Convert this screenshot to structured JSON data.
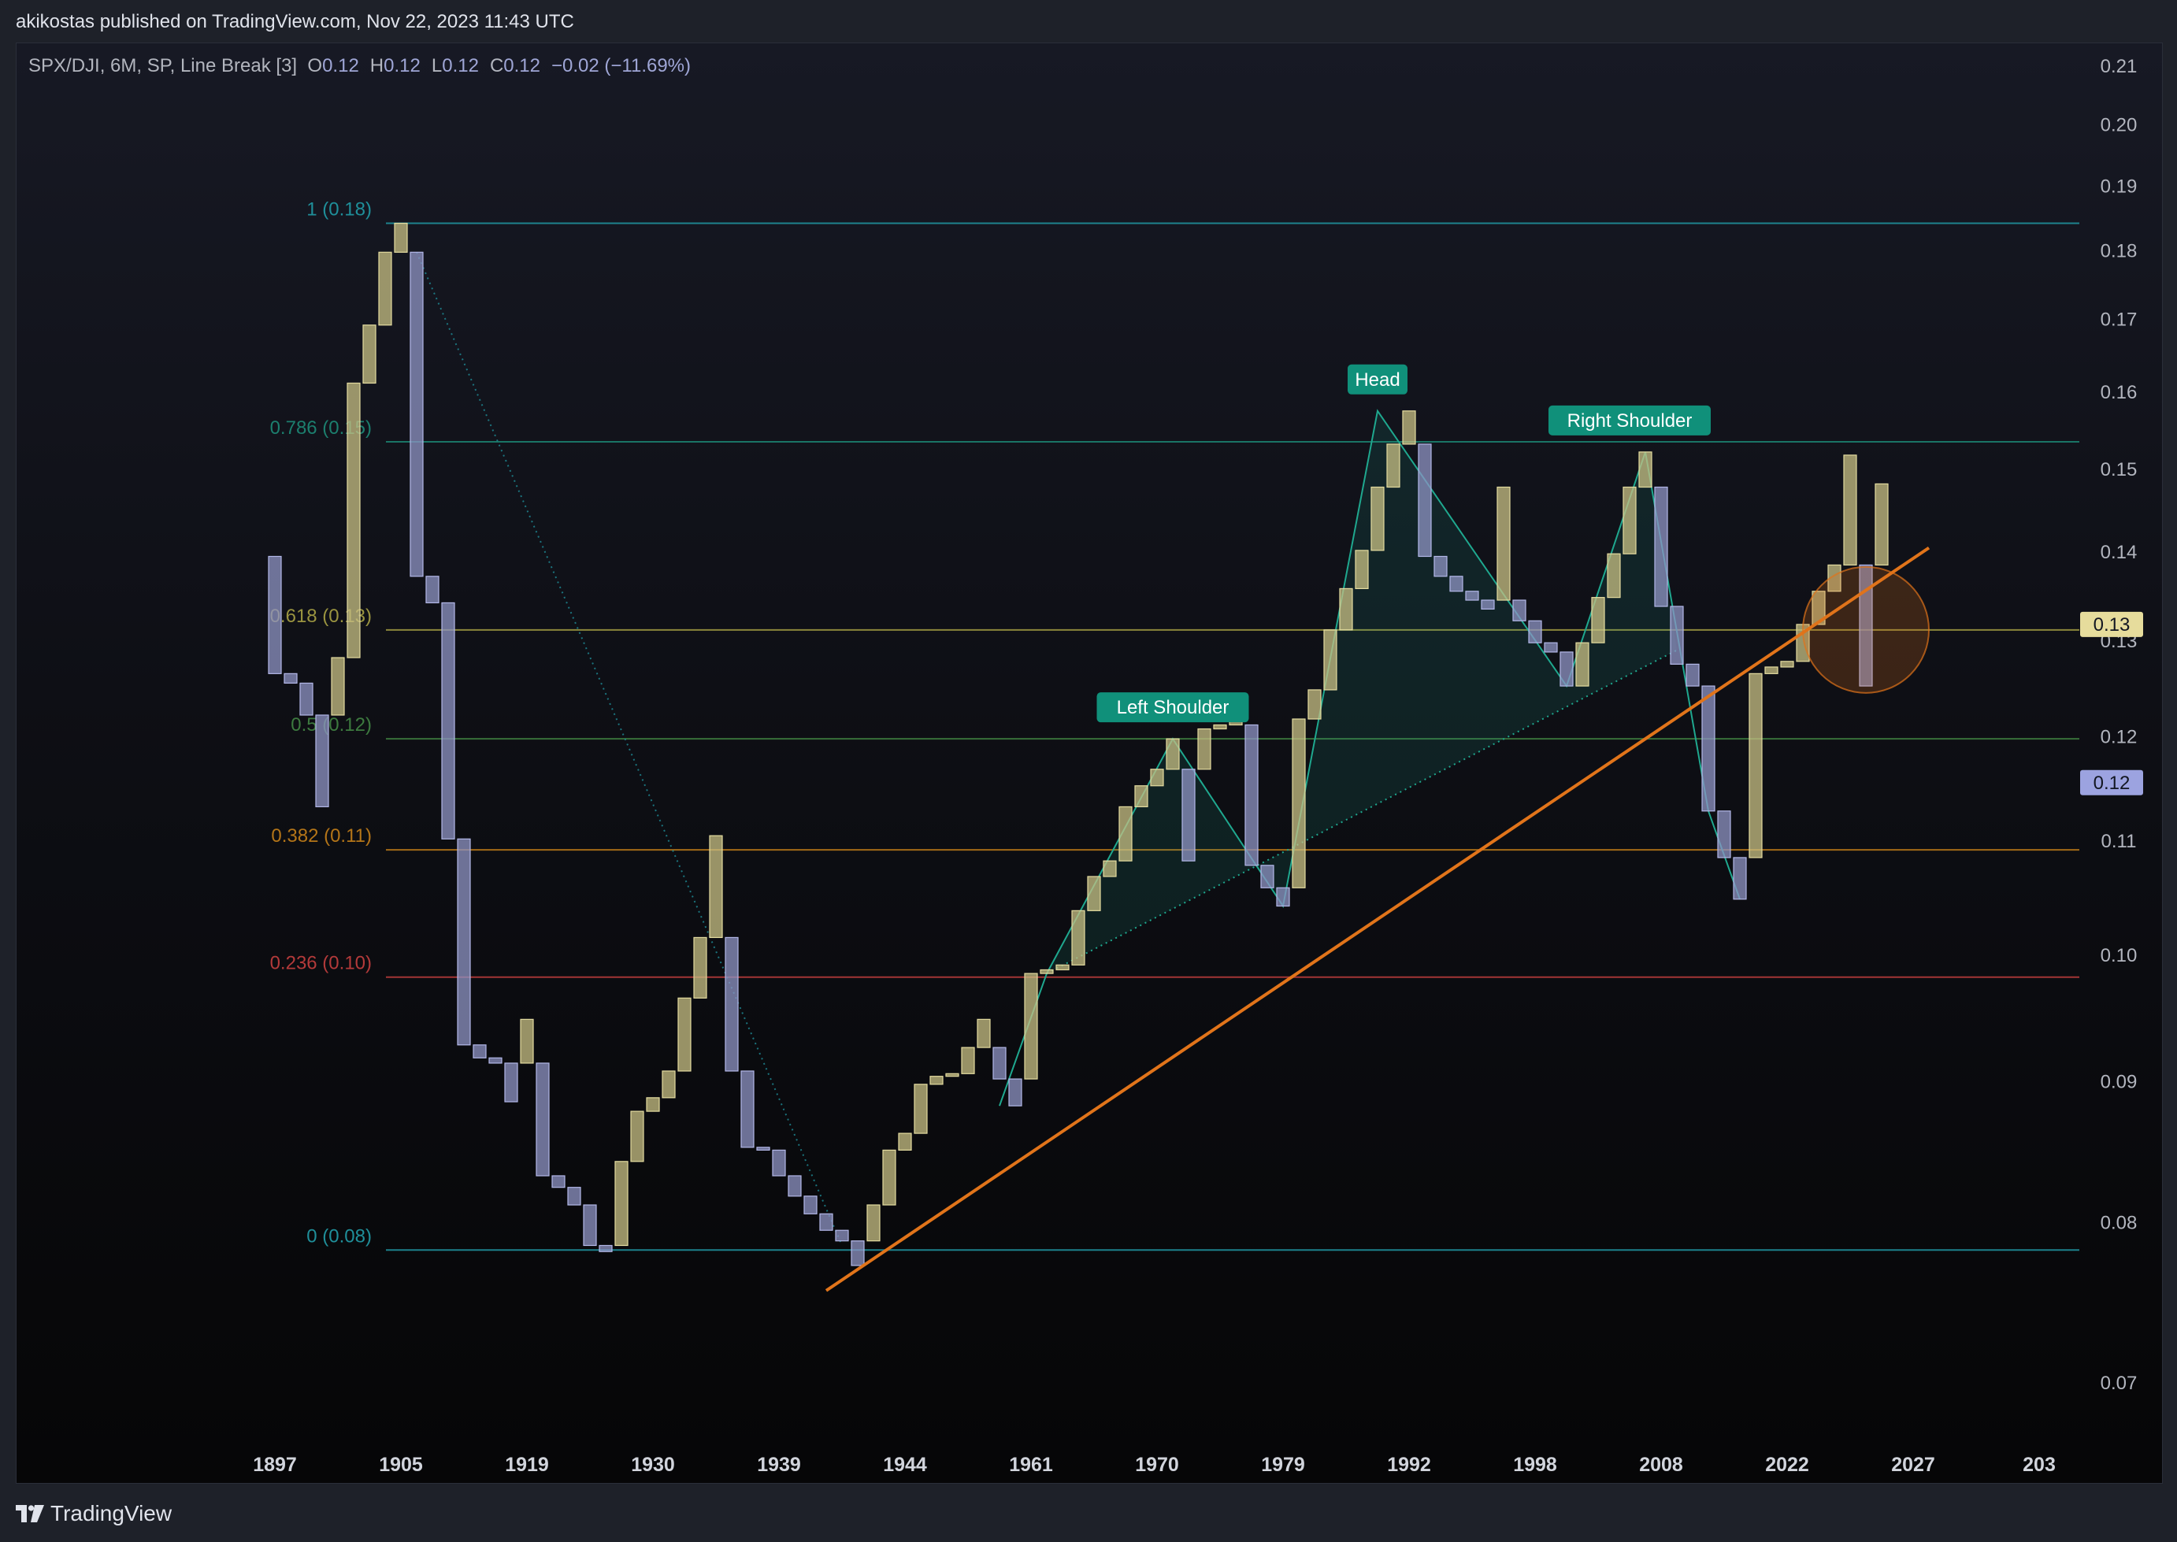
{
  "header": {
    "publisher_text": "akikostas published on TradingView.com, Nov 22, 2023 11:43 UTC"
  },
  "legend": {
    "symbol_text": "SPX/DJI, 6M, SP, Line Break [3]",
    "open_label": "O",
    "open_value": "0.12",
    "high_label": "H",
    "high_value": "0.12",
    "low_label": "L",
    "low_value": "0.12",
    "close_label": "C",
    "close_value": "0.12",
    "change_text": "−0.02 (−11.69%)"
  },
  "footer": {
    "brand": "TradingView"
  },
  "colors": {
    "bull_fill": "#c8c084",
    "bear_fill": "#8f94c4",
    "trendline": "#e1741a",
    "pattern": "#1fa88f",
    "label_bg": "#10907a",
    "price_badge_up": "#e6dc9c",
    "price_badge_down": "#9ca3e0"
  },
  "chart_data": {
    "type": "line_break",
    "title": "SPX/DJI, 6M, SP, Line Break [3]",
    "y_scale": "log",
    "ylim": [
      0.0672,
      0.2125
    ],
    "y_ticks": [
      "0.07",
      "0.08",
      "0.09",
      "0.10",
      "0.11",
      "0.12",
      "0.13",
      "0.14",
      "0.15",
      "0.16",
      "0.17",
      "0.18",
      "0.19",
      "0.20",
      "0.21"
    ],
    "y_tick_values": [
      0.07,
      0.08,
      0.09,
      0.1,
      0.11,
      0.12,
      0.13,
      0.14,
      0.15,
      0.16,
      0.17,
      0.18,
      0.19,
      0.2,
      0.21
    ],
    "x_ticks": [
      "1897",
      "1905",
      "1919",
      "1930",
      "1939",
      "1944",
      "1961",
      "1970",
      "1979",
      "1992",
      "1998",
      "2008",
      "2022",
      "2027",
      "203"
    ],
    "x_tick_index": [
      0,
      8,
      16,
      24,
      32,
      40,
      48,
      56,
      64,
      72,
      80,
      88,
      96,
      104,
      112
    ],
    "bricks": [
      {
        "i": 0,
        "open": 0.1395,
        "close": 0.1265
      },
      {
        "i": 1,
        "open": 0.1265,
        "close": 0.1255
      },
      {
        "i": 2,
        "open": 0.1255,
        "close": 0.1222
      },
      {
        "i": 3,
        "open": 0.1222,
        "close": 0.1132
      },
      {
        "i": 4,
        "open": 0.1222,
        "close": 0.1282
      },
      {
        "i": 5,
        "open": 0.1282,
        "close": 0.1612
      },
      {
        "i": 6,
        "open": 0.1612,
        "close": 0.1692
      },
      {
        "i": 7,
        "open": 0.1692,
        "close": 0.1798
      },
      {
        "i": 8,
        "open": 0.1798,
        "close": 0.1842
      },
      {
        "i": 9,
        "open": 0.1798,
        "close": 0.1372
      },
      {
        "i": 10,
        "open": 0.1372,
        "close": 0.1342
      },
      {
        "i": 11,
        "open": 0.1342,
        "close": 0.1102
      },
      {
        "i": 12,
        "open": 0.1102,
        "close": 0.0928
      },
      {
        "i": 13,
        "open": 0.0928,
        "close": 0.0918
      },
      {
        "i": 14,
        "open": 0.0918,
        "close": 0.0914
      },
      {
        "i": 15,
        "open": 0.0914,
        "close": 0.0885
      },
      {
        "i": 16,
        "open": 0.0914,
        "close": 0.0948
      },
      {
        "i": 17,
        "open": 0.0914,
        "close": 0.0832
      },
      {
        "i": 18,
        "open": 0.0832,
        "close": 0.0824
      },
      {
        "i": 19,
        "open": 0.0824,
        "close": 0.0812
      },
      {
        "i": 20,
        "open": 0.0812,
        "close": 0.0785
      },
      {
        "i": 21,
        "open": 0.0785,
        "close": 0.0781
      },
      {
        "i": 22,
        "open": 0.0785,
        "close": 0.0842
      },
      {
        "i": 23,
        "open": 0.0842,
        "close": 0.0878
      },
      {
        "i": 24,
        "open": 0.0878,
        "close": 0.0888
      },
      {
        "i": 25,
        "open": 0.0888,
        "close": 0.0908
      },
      {
        "i": 26,
        "open": 0.0908,
        "close": 0.0965
      },
      {
        "i": 27,
        "open": 0.0965,
        "close": 0.1015
      },
      {
        "i": 28,
        "open": 0.1015,
        "close": 0.1105
      },
      {
        "i": 29,
        "open": 0.1015,
        "close": 0.0908
      },
      {
        "i": 30,
        "open": 0.0908,
        "close": 0.0852
      },
      {
        "i": 31,
        "open": 0.0852,
        "close": 0.085
      },
      {
        "i": 32,
        "open": 0.085,
        "close": 0.0832
      },
      {
        "i": 33,
        "open": 0.0832,
        "close": 0.0818
      },
      {
        "i": 34,
        "open": 0.0818,
        "close": 0.0806
      },
      {
        "i": 35,
        "open": 0.0806,
        "close": 0.0795
      },
      {
        "i": 36,
        "open": 0.0795,
        "close": 0.0788
      },
      {
        "i": 37,
        "open": 0.0788,
        "close": 0.0772
      },
      {
        "i": 38,
        "open": 0.0788,
        "close": 0.0812
      },
      {
        "i": 39,
        "open": 0.0812,
        "close": 0.085
      },
      {
        "i": 40,
        "open": 0.085,
        "close": 0.0862
      },
      {
        "i": 41,
        "open": 0.0862,
        "close": 0.0898
      },
      {
        "i": 42,
        "open": 0.0898,
        "close": 0.0904
      },
      {
        "i": 43,
        "open": 0.0904,
        "close": 0.0906
      },
      {
        "i": 44,
        "open": 0.0906,
        "close": 0.0926
      },
      {
        "i": 45,
        "open": 0.0926,
        "close": 0.0948
      },
      {
        "i": 46,
        "open": 0.0926,
        "close": 0.0902
      },
      {
        "i": 47,
        "open": 0.0902,
        "close": 0.0882
      },
      {
        "i": 48,
        "open": 0.0902,
        "close": 0.0985
      },
      {
        "i": 49,
        "open": 0.0985,
        "close": 0.0988
      },
      {
        "i": 50,
        "open": 0.0988,
        "close": 0.0992
      },
      {
        "i": 51,
        "open": 0.0992,
        "close": 0.1038
      },
      {
        "i": 52,
        "open": 0.1038,
        "close": 0.1068
      },
      {
        "i": 53,
        "open": 0.1068,
        "close": 0.1082
      },
      {
        "i": 54,
        "open": 0.1082,
        "close": 0.1132
      },
      {
        "i": 55,
        "open": 0.1132,
        "close": 0.1152
      },
      {
        "i": 56,
        "open": 0.1152,
        "close": 0.1168
      },
      {
        "i": 57,
        "open": 0.1168,
        "close": 0.1198
      },
      {
        "i": 58,
        "open": 0.1168,
        "close": 0.1082
      },
      {
        "i": 59,
        "open": 0.1168,
        "close": 0.1208
      },
      {
        "i": 60,
        "open": 0.1208,
        "close": 0.1212
      },
      {
        "i": 61,
        "open": 0.1212,
        "close": 0.1228
      },
      {
        "i": 62,
        "open": 0.1212,
        "close": 0.1078
      },
      {
        "i": 63,
        "open": 0.1078,
        "close": 0.1058
      },
      {
        "i": 64,
        "open": 0.1058,
        "close": 0.1042
      },
      {
        "i": 65,
        "open": 0.1058,
        "close": 0.1218
      },
      {
        "i": 66,
        "open": 0.1218,
        "close": 0.1248
      },
      {
        "i": 67,
        "open": 0.1248,
        "close": 0.1312
      },
      {
        "i": 68,
        "open": 0.1312,
        "close": 0.1358
      },
      {
        "i": 69,
        "open": 0.1358,
        "close": 0.1402
      },
      {
        "i": 70,
        "open": 0.1402,
        "close": 0.1478
      },
      {
        "i": 71,
        "open": 0.1478,
        "close": 0.1532
      },
      {
        "i": 72,
        "open": 0.1532,
        "close": 0.1575
      },
      {
        "i": 73,
        "open": 0.1532,
        "close": 0.1395
      },
      {
        "i": 74,
        "open": 0.1395,
        "close": 0.1372
      },
      {
        "i": 75,
        "open": 0.1372,
        "close": 0.1355
      },
      {
        "i": 76,
        "open": 0.1355,
        "close": 0.1345
      },
      {
        "i": 77,
        "open": 0.1345,
        "close": 0.1335
      },
      {
        "i": 78,
        "open": 0.1345,
        "close": 0.1478
      },
      {
        "i": 79,
        "open": 0.1345,
        "close": 0.1322
      },
      {
        "i": 80,
        "open": 0.1322,
        "close": 0.1298
      },
      {
        "i": 81,
        "open": 0.1298,
        "close": 0.1288
      },
      {
        "i": 82,
        "open": 0.1288,
        "close": 0.1252
      },
      {
        "i": 83,
        "open": 0.1252,
        "close": 0.1298
      },
      {
        "i": 84,
        "open": 0.1298,
        "close": 0.1348
      },
      {
        "i": 85,
        "open": 0.1348,
        "close": 0.1398
      },
      {
        "i": 86,
        "open": 0.1398,
        "close": 0.1478
      },
      {
        "i": 87,
        "open": 0.1478,
        "close": 0.1522
      },
      {
        "i": 88,
        "open": 0.1478,
        "close": 0.1338
      },
      {
        "i": 89,
        "open": 0.1338,
        "close": 0.1275
      },
      {
        "i": 90,
        "open": 0.1275,
        "close": 0.1252
      },
      {
        "i": 91,
        "open": 0.1252,
        "close": 0.1128
      },
      {
        "i": 92,
        "open": 0.1128,
        "close": 0.1085
      },
      {
        "i": 93,
        "open": 0.1085,
        "close": 0.1048
      },
      {
        "i": 94,
        "open": 0.1085,
        "close": 0.1265
      },
      {
        "i": 95,
        "open": 0.1265,
        "close": 0.1272
      },
      {
        "i": 96,
        "open": 0.1272,
        "close": 0.1278
      },
      {
        "i": 97,
        "open": 0.1278,
        "close": 0.1318
      },
      {
        "i": 98,
        "open": 0.1318,
        "close": 0.1355
      },
      {
        "i": 99,
        "open": 0.1355,
        "close": 0.1385
      },
      {
        "i": 100,
        "open": 0.1385,
        "close": 0.1518
      },
      {
        "i": 101,
        "open": 0.1385,
        "close": 0.1252
      },
      {
        "i": 102,
        "open": 0.1385,
        "close": 0.1482
      }
    ],
    "fib_levels": [
      {
        "label": "1 (0.18)",
        "value": 0.1842,
        "color": "#1f8f9a"
      },
      {
        "label": "0.786 (0.15)",
        "value": 0.1535,
        "color": "#1c7f6e"
      },
      {
        "label": "0.618 (0.13)",
        "value": 0.1312,
        "color": "#9a9440"
      },
      {
        "label": "0.5 (0.12)",
        "value": 0.1198,
        "color": "#3d7a3f"
      },
      {
        "label": "0.382 (0.11)",
        "value": 0.1092,
        "color": "#b47518"
      },
      {
        "label": "0.236 (0.10)",
        "value": 0.0982,
        "color": "#b33a3a"
      },
      {
        "label": "0 (0.08)",
        "value": 0.0782,
        "color": "#1f8f9a"
      }
    ],
    "pattern_labels": [
      {
        "text": "Left Shoulder",
        "i": 57,
        "value": 0.1198
      },
      {
        "text": "Head",
        "i": 70,
        "value": 0.1575
      },
      {
        "text": "Right Shoulder",
        "i": 86,
        "value": 0.1522
      }
    ],
    "price_badges": [
      {
        "text": "0.13",
        "value": 0.1318,
        "kind": "up"
      },
      {
        "text": "0.12",
        "value": 0.1155,
        "kind": "down"
      }
    ]
  }
}
